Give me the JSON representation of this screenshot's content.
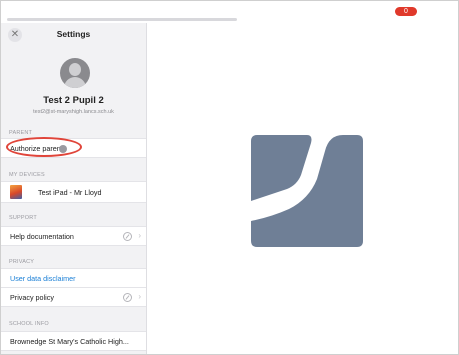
{
  "topbar": {
    "badge": "0"
  },
  "sidebar": {
    "title": "Settings",
    "profile": {
      "name": "Test 2 Pupil 2",
      "email": "test2@st-maryshigh.lancs.sch.uk"
    },
    "sections": {
      "parent": {
        "label": "PARENT",
        "items": [
          "Authorize parent"
        ]
      },
      "devices": {
        "label": "MY DEVICES",
        "items": [
          "Test iPad - Mr Lloyd"
        ]
      },
      "support": {
        "label": "SUPPORT",
        "items": [
          "Help documentation"
        ]
      },
      "privacy": {
        "label": "PRIVACY",
        "items": [
          "User data disclaimer",
          "Privacy policy"
        ]
      },
      "school": {
        "label": "SCHOOL INFO",
        "items": [
          "Brownedge St Mary's Catholic High..."
        ]
      }
    }
  },
  "icons": {
    "close": "close-icon",
    "info": "info-icon",
    "chevron": "chevron-right-icon"
  },
  "colors": {
    "accent_link": "#1a7fd6",
    "annotation": "#e0453a",
    "logo": "#6f7f96",
    "badge": "#e0392b"
  }
}
